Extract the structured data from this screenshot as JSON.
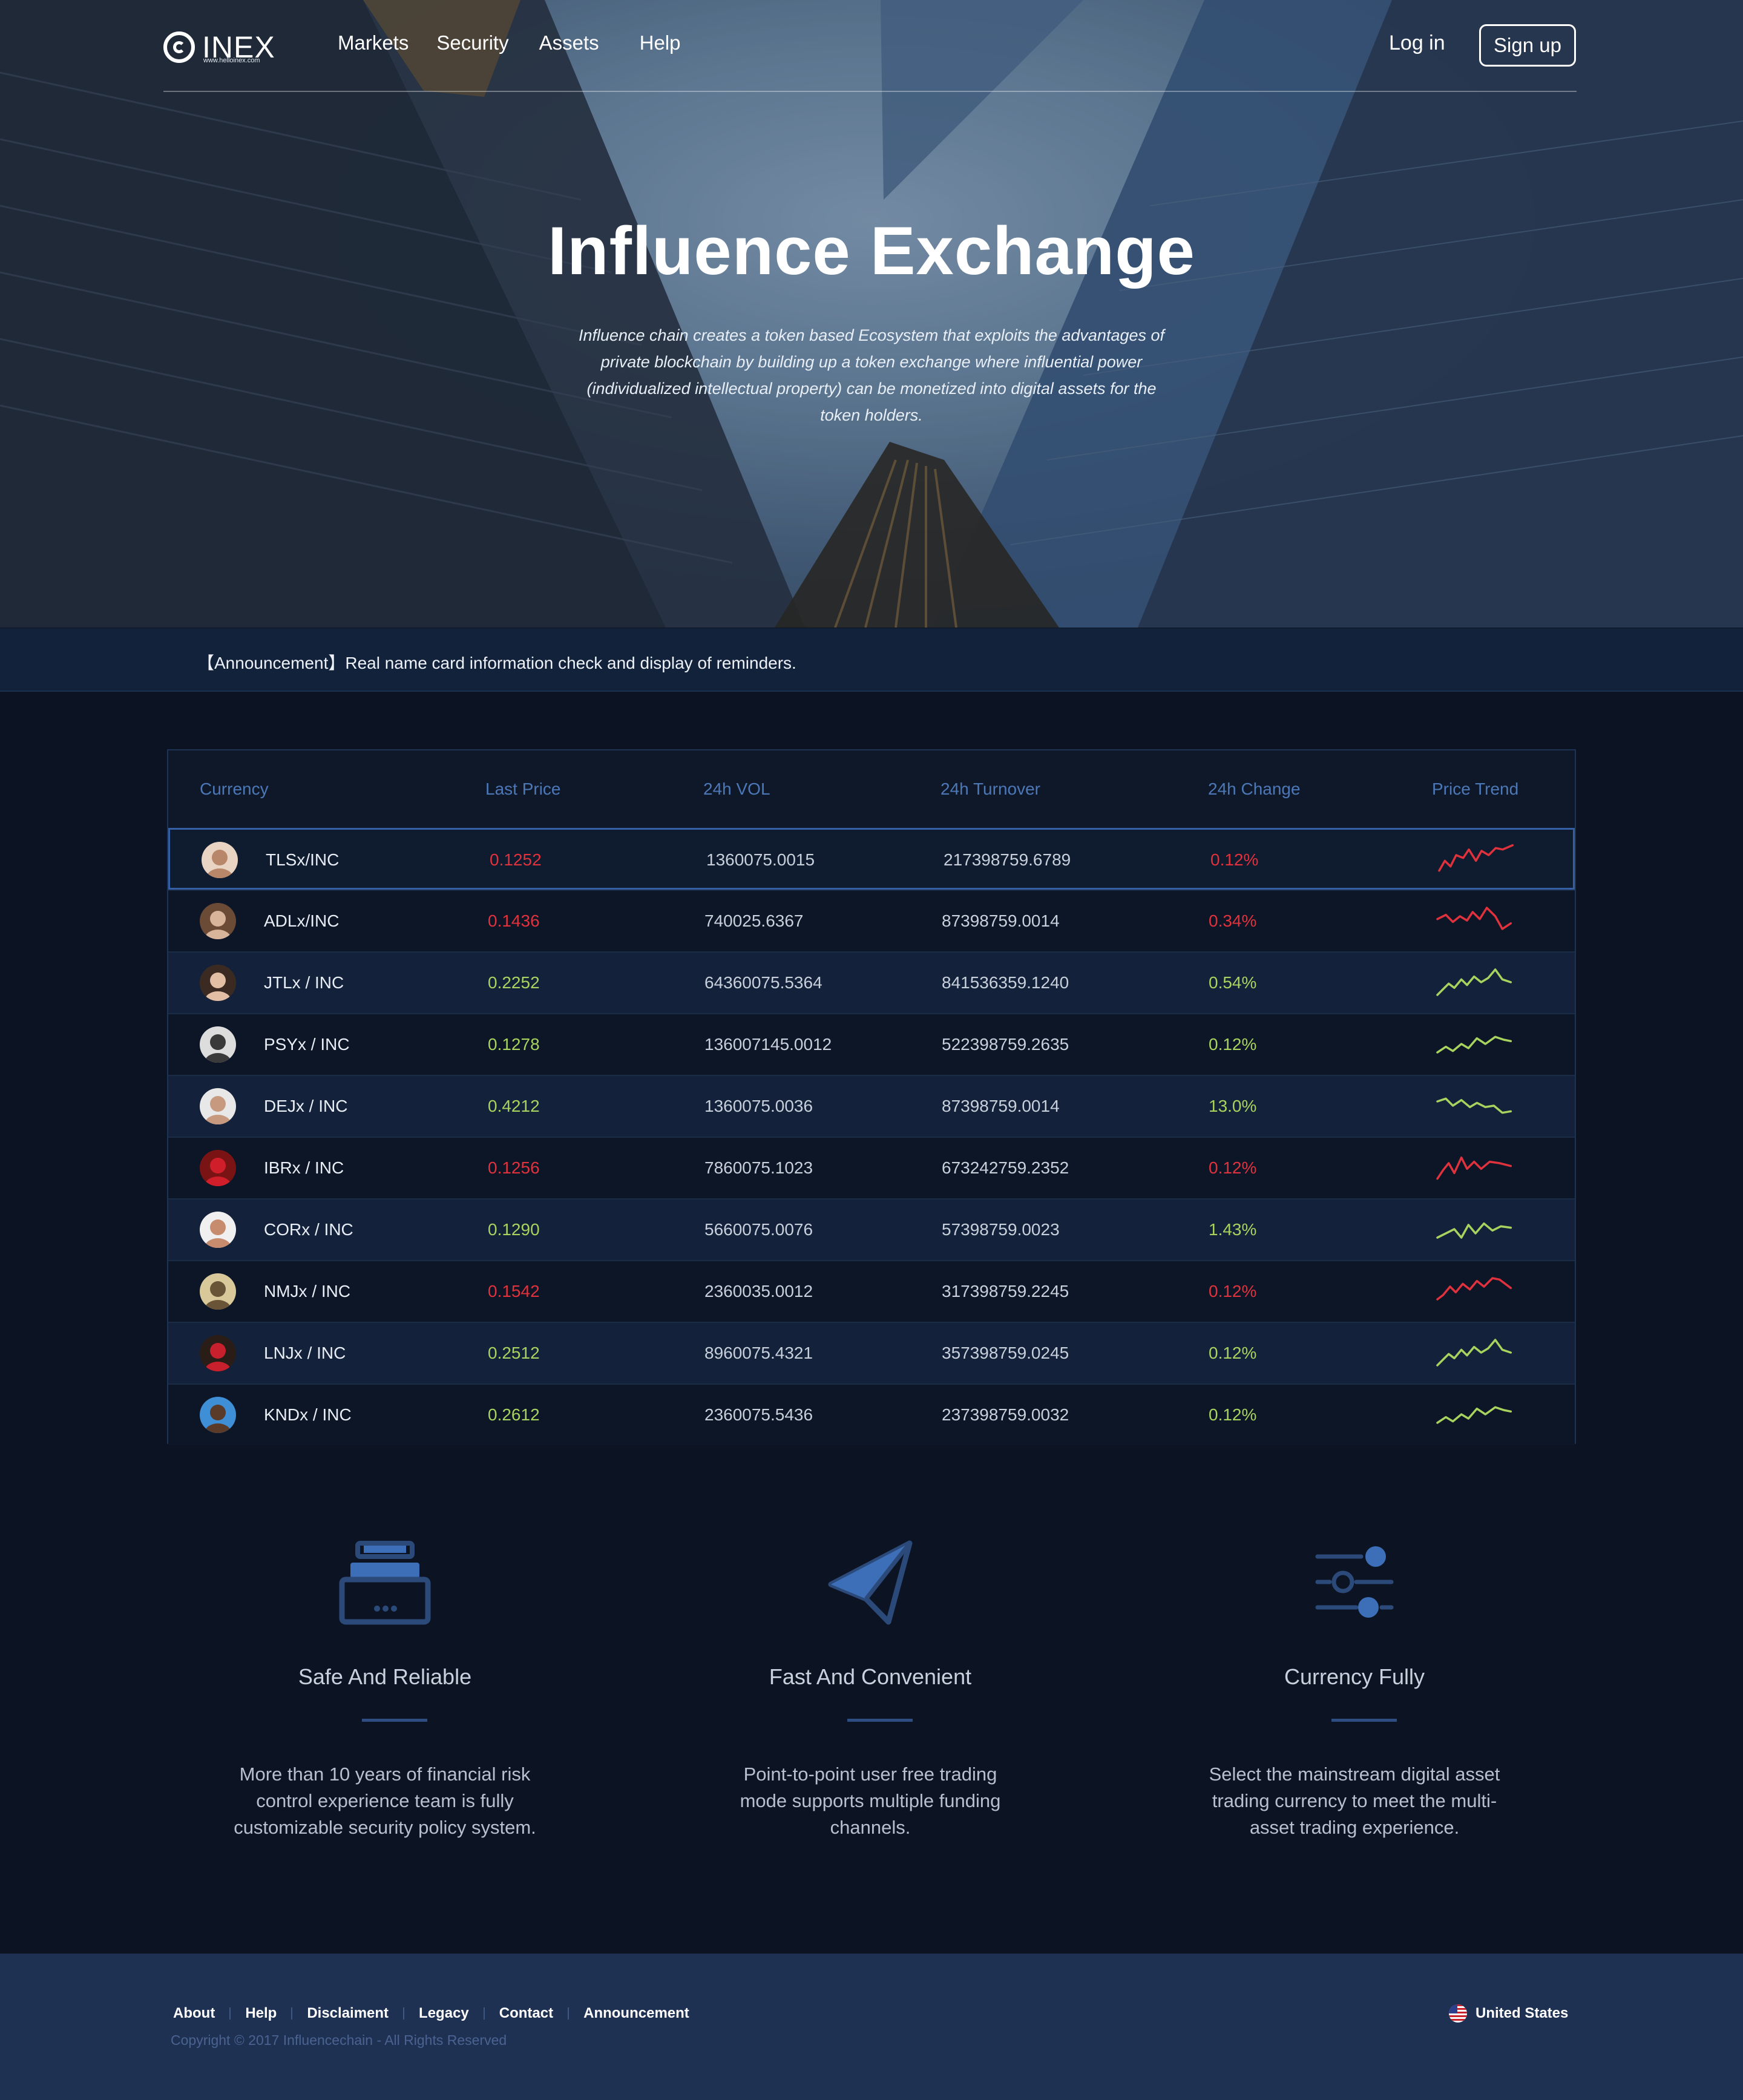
{
  "brand": {
    "name": "INEX",
    "sub": "www.helloinex.com"
  },
  "nav": {
    "links": [
      "Markets",
      "Security",
      "Assets",
      "Help"
    ],
    "login": "Log in",
    "signup": "Sign up"
  },
  "hero": {
    "title": "Influence Exchange",
    "description": "Influence chain creates a token based Ecosystem that exploits the advantages of private blockchain by building up a token exchange where influential power (individualized intellectual property) can be monetized into digital assets for the token holders."
  },
  "announcement": "【Announcement】Real name card information check and display of reminders.",
  "table": {
    "headers": [
      "Currency",
      "Last Price",
      "24h VOL",
      "24h Turnover",
      "24h Change",
      "Price Trend"
    ],
    "rows": [
      {
        "pair": "TLSx/INC",
        "price": "0.1252",
        "vol": "1360075.0015",
        "turnover": "217398759.6789",
        "change": "0.12%",
        "trend": "down"
      },
      {
        "pair": "ADLx/INC",
        "price": "0.1436",
        "vol": "740025.6367",
        "turnover": "87398759.0014",
        "change": "0.34%",
        "trend": "down"
      },
      {
        "pair": "JTLx / INC",
        "price": "0.2252",
        "vol": "64360075.5364",
        "turnover": "841536359.1240",
        "change": "0.54%",
        "trend": "up"
      },
      {
        "pair": "PSYx / INC",
        "price": "0.1278",
        "vol": "136007145.0012",
        "turnover": "522398759.2635",
        "change": "0.12%",
        "trend": "up"
      },
      {
        "pair": "DEJx / INC",
        "price": "0.4212",
        "vol": "1360075.0036",
        "turnover": "87398759.0014",
        "change": "13.0%",
        "trend": "up"
      },
      {
        "pair": "IBRx / INC",
        "price": "0.1256",
        "vol": "7860075.1023",
        "turnover": "673242759.2352",
        "change": "0.12%",
        "trend": "down"
      },
      {
        "pair": "CORx / INC",
        "price": "0.1290",
        "vol": "5660075.0076",
        "turnover": "57398759.0023",
        "change": "1.43%",
        "trend": "up"
      },
      {
        "pair": "NMJx / INC",
        "price": "0.1542",
        "vol": "2360035.0012",
        "turnover": "317398759.2245",
        "change": "0.12%",
        "trend": "down"
      },
      {
        "pair": "LNJx / INC",
        "price": "0.2512",
        "vol": "8960075.4321",
        "turnover": "357398759.0245",
        "change": "0.12%",
        "trend": "up"
      },
      {
        "pair": "KNDx / INC",
        "price": "0.2612",
        "vol": "2360075.5436",
        "turnover": "237398759.0032",
        "change": "0.12%",
        "trend": "up"
      }
    ]
  },
  "colors": {
    "down": "#e0323d",
    "up": "#a8d35e",
    "accent": "#3c6fb8"
  },
  "features": [
    {
      "icon": "printer-icon",
      "title": "Safe And Reliable",
      "desc": "More than 10 years of financial risk control experience team is fully customizable security policy system."
    },
    {
      "icon": "paper-plane-icon",
      "title": "Fast And Convenient",
      "desc": "Point-to-point user free trading mode supports multiple funding channels."
    },
    {
      "icon": "sliders-icon",
      "title": "Currency Fully",
      "desc": "Select the mainstream digital asset trading currency to meet the multi-asset trading experience."
    }
  ],
  "footer": {
    "links": [
      "About",
      "Help",
      "Disclaiment",
      "Legacy",
      "Contact",
      "Announcement"
    ],
    "copyright": "Copyright © 2017 Influencechain - All Rights Reserved",
    "region": "United States"
  }
}
